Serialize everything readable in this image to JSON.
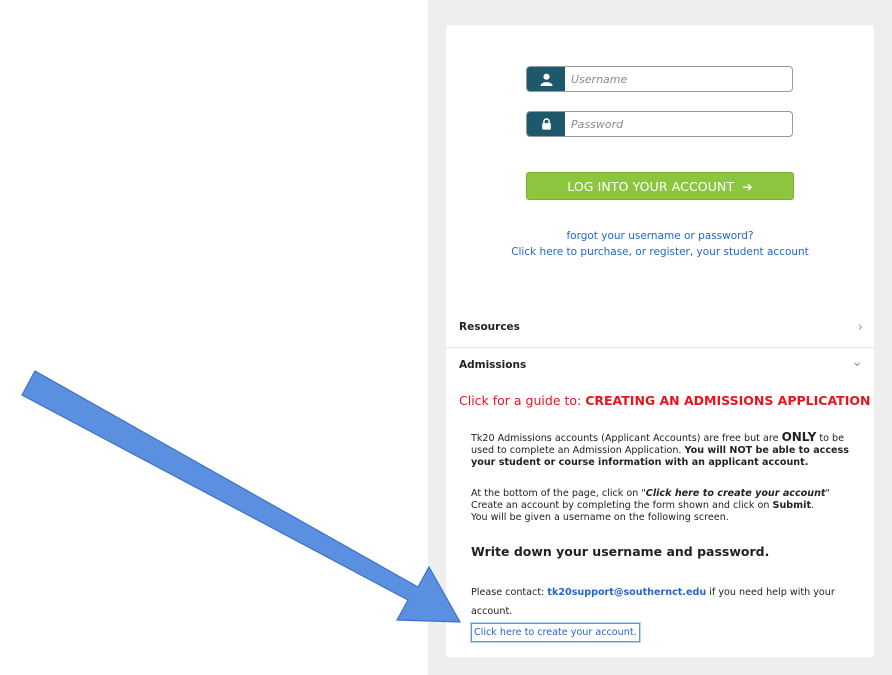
{
  "login": {
    "username_placeholder": "Username",
    "password_placeholder": "Password",
    "login_button": "LOG INTO YOUR ACCOUNT",
    "login_button_arrow": "➔",
    "forgot_link": "forgot your username or password?",
    "register_link": "Click here to purchase, or register, your student account"
  },
  "accordion": {
    "resources_label": "Resources",
    "resources_chevron": "›",
    "admissions_label": "Admissions",
    "admissions_chevron": "⌄"
  },
  "admissions": {
    "guide_prefix": "Click for a guide to: ",
    "guide_bold": "CREATING AN ADMISSIONS APPLICATION",
    "p1_a": "Tk20 Admissions accounts (Applicant Accounts) are free but are ",
    "p1_only": "ONLY",
    "p1_b": " to be used to complete an Admission Application. ",
    "p1_bold": "You will NOT be able to access your student or course information with an applicant account.",
    "p2_a": "At the bottom of the page, click on \"",
    "p2_bold": "Click here to create your account",
    "p2_b": "\"",
    "p2_c": "Create an account by completing the form shown and click on ",
    "p2_submit": "Submit",
    "p2_d": ".",
    "p2_e": "You will be given a username on the following screen.",
    "heading": "Write down your username and password.",
    "contact_a": "Please contact: ",
    "contact_email": "tk20support@southernct.edu",
    "contact_b": " if you need help with your account.",
    "create_link": "Click here to create your account."
  },
  "colors": {
    "brand_teal": "#1c5a6b",
    "login_green": "#8cc63f",
    "link_blue": "#2266cc",
    "alert_red": "#e8141b",
    "annotation_arrow": "#5b8fe0"
  },
  "icons": [
    "user-icon",
    "lock-icon",
    "arrow-right-icon",
    "chevron-right-icon",
    "chevron-down-icon",
    "annotation-arrow"
  ]
}
